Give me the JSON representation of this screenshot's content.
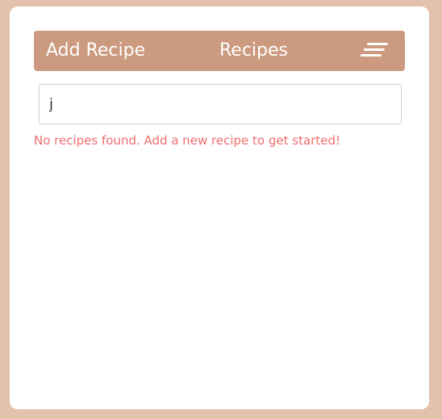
{
  "header": {
    "add_recipe_label": "Add Recipe",
    "title": "Recipes",
    "menu_icon": "menu-icon"
  },
  "search": {
    "value": "j",
    "placeholder": ""
  },
  "status": {
    "empty_message": "No recipes found. Add a new recipe to get started!"
  },
  "colors": {
    "page_background": "#e2c2ab",
    "card_background": "#ffffff",
    "header_background": "#cb9a7f",
    "header_text": "#ffffff",
    "empty_message_text": "#ef6e6e"
  }
}
